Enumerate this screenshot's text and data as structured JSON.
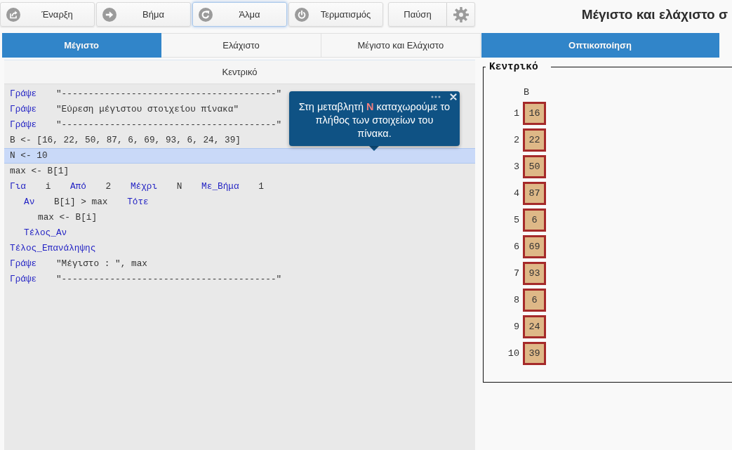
{
  "toolbar": {
    "buttons": [
      {
        "label": "Έναρξη",
        "kind": "start",
        "focused": false
      },
      {
        "label": "Βήμα",
        "kind": "step",
        "focused": false
      },
      {
        "label": "Άλμα",
        "kind": "jump",
        "focused": true
      },
      {
        "label": "Τερματισμός",
        "kind": "stop",
        "focused": false
      }
    ],
    "pause": {
      "label": "Παύση"
    }
  },
  "title": "Μέγιστο και ελάχιστο σ",
  "tabs": [
    {
      "label": "Μέγιστο",
      "selected": true
    },
    {
      "label": "Ελάχιστο",
      "selected": false
    },
    {
      "label": "Μέγιστο και Ελάχιστο",
      "selected": false
    }
  ],
  "view_tabs": [
    {
      "label": "Οπτικοποίηση",
      "selected": true
    }
  ],
  "code_panel": {
    "header": "Κεντρικό",
    "lines": [
      {
        "tokens": [
          {
            "kind": "keyword",
            "text": "Γράψε"
          },
          {
            "kind": "code",
            "text": "\"----------------------------------------\""
          }
        ],
        "selected": false
      },
      {
        "tokens": [
          {
            "kind": "keyword",
            "text": "Γράψε"
          },
          {
            "kind": "code",
            "text": "\"Εύρεση μέγιστου στοιχείου πίνακα\""
          }
        ],
        "selected": false
      },
      {
        "tokens": [
          {
            "kind": "keyword",
            "text": "Γράψε"
          },
          {
            "kind": "code",
            "text": "\"----------------------------------------\""
          }
        ],
        "selected": false
      },
      {
        "tokens": [
          {
            "kind": "code",
            "text": "B <- [16, 22, 50, 87, 6, 69, 93, 6, 24, 39]"
          }
        ],
        "selected": false
      },
      {
        "tokens": [
          {
            "kind": "code",
            "text": "N <- 10"
          }
        ],
        "selected": true
      },
      {
        "tokens": [
          {
            "kind": "code",
            "text": "max <- B[1]"
          }
        ],
        "selected": false
      },
      {
        "tokens": [
          {
            "kind": "keyword",
            "text": "Για"
          },
          {
            "kind": "code",
            "text": "i"
          },
          {
            "kind": "keyword",
            "text": "Από"
          },
          {
            "kind": "code",
            "text": "2"
          },
          {
            "kind": "keyword",
            "text": "Μέχρι"
          },
          {
            "kind": "code",
            "text": "N"
          },
          {
            "kind": "keyword",
            "text": "Με_Βήμα"
          },
          {
            "kind": "code",
            "text": "1"
          }
        ],
        "selected": false,
        "children": [
          {
            "tokens": [
              {
                "kind": "keyword",
                "text": "Αν"
              },
              {
                "kind": "code",
                "text": "B[i] > max"
              },
              {
                "kind": "keyword",
                "text": "Τότε"
              }
            ],
            "selected": false,
            "children": [
              {
                "tokens": [
                  {
                    "kind": "code",
                    "text": "max <- B[i]"
                  }
                ],
                "selected": false
              }
            ]
          },
          {
            "tokens": [
              {
                "kind": "keyword",
                "text": "Τέλος_Αν"
              }
            ],
            "selected": false
          }
        ]
      },
      {
        "tokens": [
          {
            "kind": "keyword",
            "text": "Τέλος_Επανάληψης"
          }
        ],
        "selected": false
      },
      {
        "tokens": [
          {
            "kind": "keyword",
            "text": "Γράψε"
          },
          {
            "kind": "code",
            "text": "\"Μέγιστο : \", max"
          }
        ],
        "selected": false
      },
      {
        "tokens": [
          {
            "kind": "keyword",
            "text": "Γράψε"
          },
          {
            "kind": "code",
            "text": "\"----------------------------------------\""
          }
        ],
        "selected": false
      }
    ]
  },
  "tooltip": {
    "text": "Στη μεταβλητή **N** καταχωρούμε το πλήθος των στοιχείων του πίνακα."
  },
  "visualization": {
    "legend": "Κεντρικό",
    "array": {
      "name": "B",
      "cells": [
        {
          "index": "1",
          "value": "16"
        },
        {
          "index": "2",
          "value": "22"
        },
        {
          "index": "3",
          "value": "50"
        },
        {
          "index": "4",
          "value": "87"
        },
        {
          "index": "5",
          "value": "6"
        },
        {
          "index": "6",
          "value": "69"
        },
        {
          "index": "7",
          "value": "93"
        },
        {
          "index": "8",
          "value": "6"
        },
        {
          "index": "9",
          "value": "24"
        },
        {
          "index": "10",
          "value": "39"
        }
      ]
    }
  }
}
